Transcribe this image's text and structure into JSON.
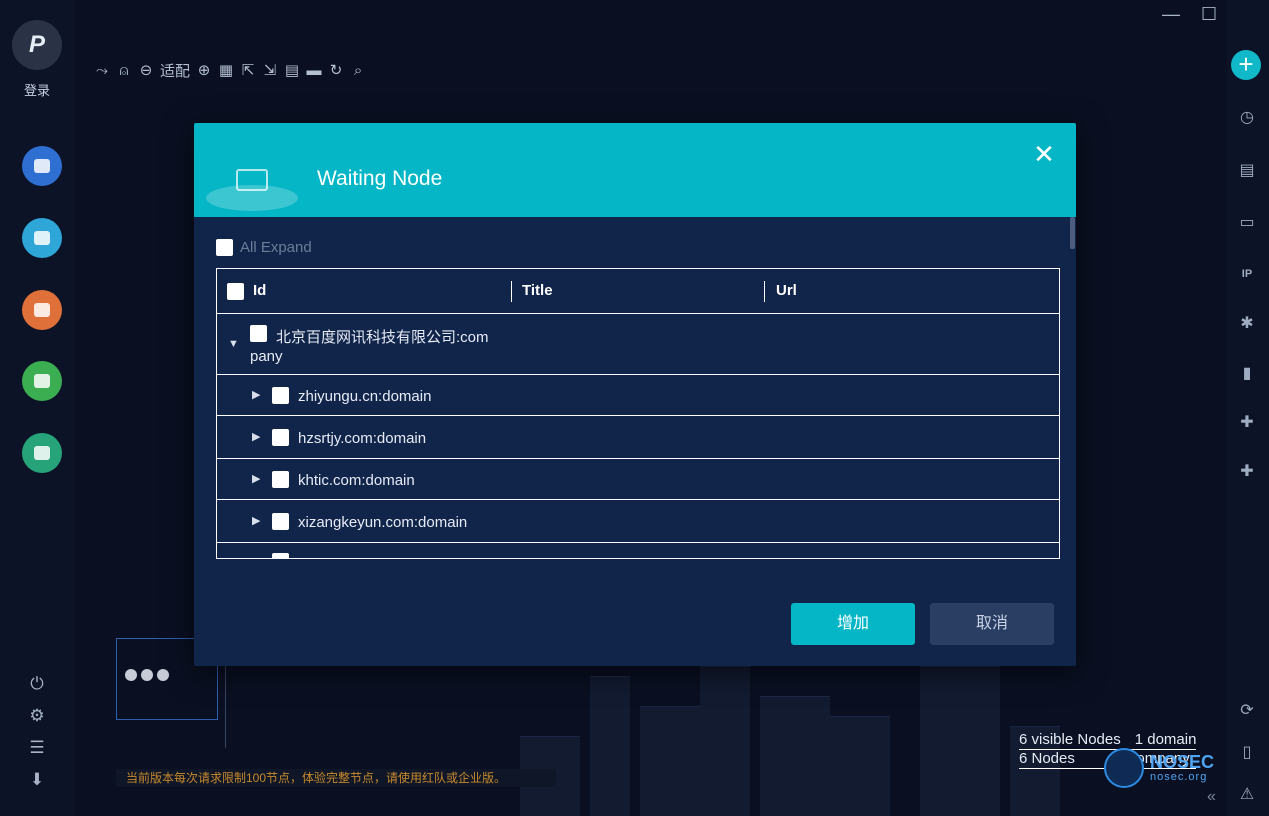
{
  "app": {
    "login_label": "登录",
    "logo_glyph": "P",
    "window_controls": [
      "—",
      "☐",
      "✕"
    ]
  },
  "left_nav": {
    "items": [
      {
        "name": "spy-icon",
        "color": "#2f6fd1"
      },
      {
        "name": "server-list-icon",
        "color": "#2ea6d8"
      },
      {
        "name": "asset-icon",
        "color": "#e0703a"
      },
      {
        "name": "chart-icon",
        "color": "#3cae52"
      },
      {
        "name": "plugin-icon",
        "color": "#27a37a"
      }
    ],
    "bottom": [
      "⏻",
      "⚙",
      "☰",
      "⬇"
    ]
  },
  "toolbar": {
    "items": [
      "⤳",
      "⍝",
      "⊖",
      "适配",
      "⊕",
      "▦",
      "⇱",
      "⇲",
      "▤",
      "▬",
      "↻",
      "⌕"
    ],
    "fit_label": "适配"
  },
  "right_nav": {
    "plus": "+",
    "items": [
      "◷",
      "▤",
      "▭",
      "IP",
      "✱",
      "▮",
      "✚",
      "✚",
      "⟳",
      "▯",
      "⚠"
    ]
  },
  "dialog": {
    "title": "Waiting Node",
    "close_glyph": "✕",
    "all_expand_label": "All Expand",
    "columns": {
      "id": "Id",
      "title": "Title",
      "url": "Url"
    },
    "rows": [
      {
        "label": "北京百度网讯科技有限公司:com",
        "wrap": "pany",
        "expanded": true,
        "level": 0
      },
      {
        "label": "zhiyungu.cn:domain",
        "expanded": false,
        "level": 1
      },
      {
        "label": "hzsrtjy.com:domain",
        "expanded": false,
        "level": 1
      },
      {
        "label": "khtic.com:domain",
        "expanded": false,
        "level": 1
      },
      {
        "label": "xizangkeyun.com:domain",
        "expanded": false,
        "level": 1
      }
    ],
    "buttons": {
      "add": "增加",
      "cancel": "取消"
    }
  },
  "footer": {
    "notice": "当前版本每次请求限制100节点，体验完整节点，请使用红队或企业版。",
    "visible_nodes": "6 visible Nodes",
    "domain_count": "1 domain",
    "nodes": "6 Nodes",
    "company_label": "company",
    "brand": "NOSEC",
    "brand_url": "nosec.org",
    "collapse": "«"
  }
}
